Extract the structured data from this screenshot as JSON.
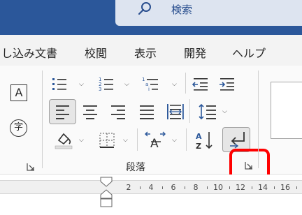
{
  "search": {
    "label": "検索"
  },
  "tabs": [
    {
      "label": "し込み文書"
    },
    {
      "label": "校閲"
    },
    {
      "label": "表示"
    },
    {
      "label": "開発"
    },
    {
      "label": "ヘルプ"
    }
  ],
  "ribbon": {
    "paragraph_group_label": "段落",
    "font_left_glyphs": {
      "a_box": "A",
      "ji_circle": "字"
    }
  },
  "ruler": {
    "numbers": [
      "2",
      "4",
      "6",
      "8",
      "10",
      "12",
      "14",
      "16"
    ]
  },
  "colors": {
    "title_bar": "#2b579a",
    "accent_red": "#ff0000",
    "icon_blue": "#2b579a"
  }
}
